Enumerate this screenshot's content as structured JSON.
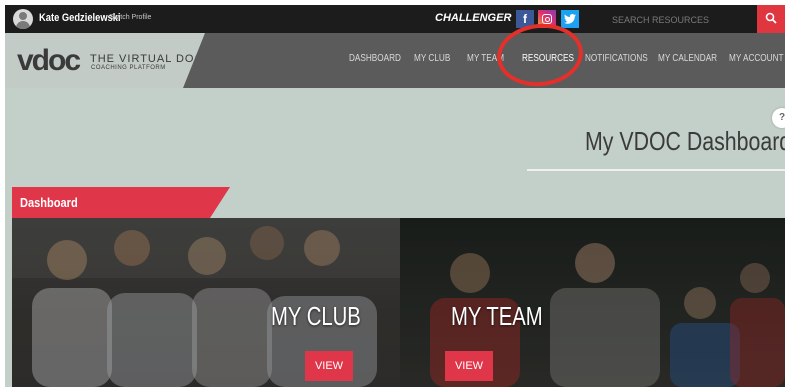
{
  "topbar": {
    "user_name": "Kate Gedzielewski",
    "switch_profile": "Switch Profile",
    "program": "CHALLENGER",
    "social": {
      "facebook": "f",
      "instagram": "instagram-icon",
      "twitter": "twitter-icon"
    },
    "search_placeholder": "SEARCH RESOURCES"
  },
  "logo": {
    "mark": "vdoc",
    "title": "THE VIRTUAL DOC",
    "subtitle": "COACHING PLATFORM"
  },
  "nav": {
    "items": [
      {
        "label": "DASHBOARD"
      },
      {
        "label": "MY CLUB"
      },
      {
        "label": "MY TEAM"
      },
      {
        "label": "RESOURCES"
      },
      {
        "label": "NOTIFICATIONS"
      },
      {
        "label": "MY CALENDAR"
      },
      {
        "label": "MY ACCOUNT"
      }
    ]
  },
  "page": {
    "title": "My VDOC Dashboard",
    "help": "?",
    "section": "Dashboard"
  },
  "cards": [
    {
      "label": "MY CLUB",
      "button": "VIEW"
    },
    {
      "label": "MY TEAM",
      "button": "VIEW"
    }
  ],
  "colors": {
    "accent_red": "#e0364a",
    "topbar_bg": "#1c1c1c",
    "nav_bg": "#5b5b5b",
    "content_bg": "#c3cfc9",
    "annotation_red": "#e3302b"
  }
}
